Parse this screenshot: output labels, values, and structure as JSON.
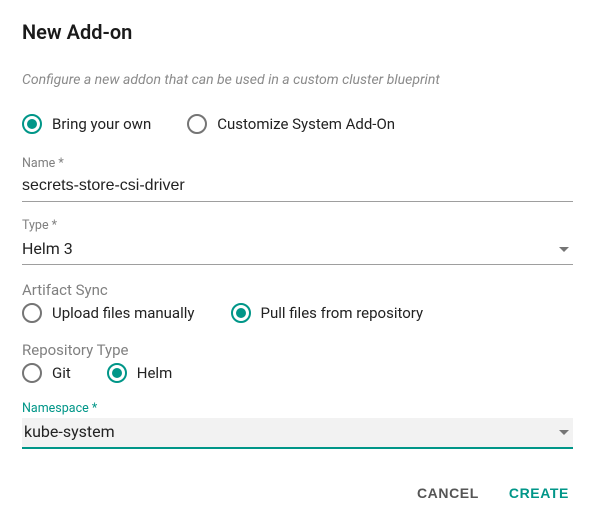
{
  "header": {
    "title": "New Add-on"
  },
  "subtitle": "Configure a new addon that can be used in a custom cluster blueprint",
  "mode": {
    "byo": {
      "label": "Bring your own",
      "selected": true
    },
    "custom": {
      "label": "Customize System Add-On",
      "selected": false
    }
  },
  "fields": {
    "name": {
      "label": "Name *",
      "value": "secrets-store-csi-driver"
    },
    "type": {
      "label": "Type *",
      "value": "Helm 3"
    },
    "artifact_sync": {
      "label": "Artifact Sync",
      "upload": {
        "label": "Upload files manually",
        "selected": false
      },
      "pull": {
        "label": "Pull files from repository",
        "selected": true
      }
    },
    "repo_type": {
      "label": "Repository Type",
      "git": {
        "label": "Git",
        "selected": false
      },
      "helm": {
        "label": "Helm",
        "selected": true
      }
    },
    "namespace": {
      "label": "Namespace *",
      "value": "kube-system"
    }
  },
  "actions": {
    "cancel": "CANCEL",
    "create": "CREATE"
  }
}
